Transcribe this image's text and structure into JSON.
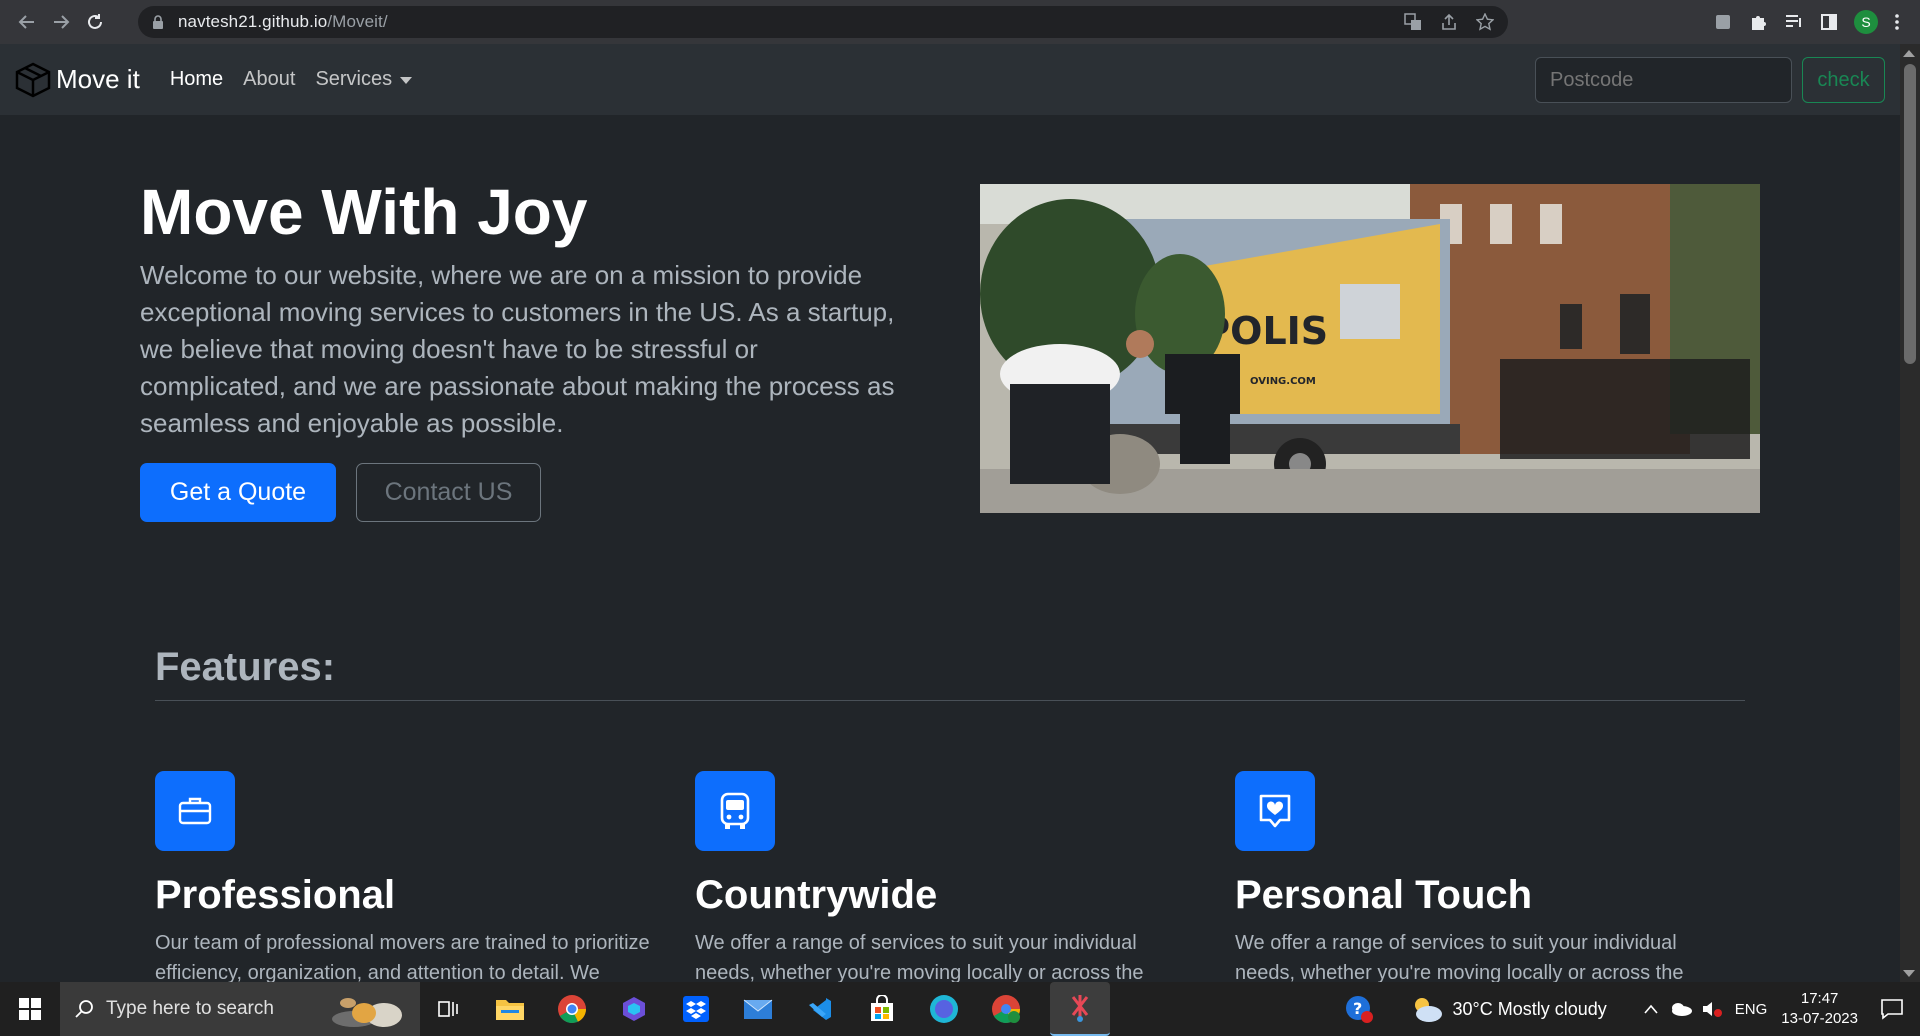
{
  "browser": {
    "url_host": "navtesh21.github.io",
    "url_path": "/Moveit/",
    "profile_initial": "S"
  },
  "navbar": {
    "brand": "Move it",
    "links": [
      {
        "label": "Home",
        "active": true
      },
      {
        "label": "About",
        "active": false
      },
      {
        "label": "Services",
        "active": false,
        "dropdown": true
      }
    ],
    "postcode_placeholder": "Postcode",
    "check_label": "check"
  },
  "hero": {
    "title": "Move With Joy",
    "text": "Welcome to our website, where we are on a mission to provide exceptional moving services to customers in the US. As a startup, we believe that moving doesn't have to be stressful or complicated, and we are passionate about making the process as seamless and enjoyable as possible.",
    "quote_button": "Get a Quote",
    "contact_button": "Contact US",
    "image_truck_text": "OPOLIS",
    "image_truck_web": "OVING.COM"
  },
  "features": {
    "heading": "Features:",
    "items": [
      {
        "icon": "briefcase-icon",
        "title": "Professional",
        "text": "Our team of professional movers are trained to prioritize efficiency, organization, and attention to detail. We"
      },
      {
        "icon": "bus-icon",
        "title": "Countrywide",
        "text": "We offer a range of services to suit your individual needs, whether you're moving locally or across the country. Our"
      },
      {
        "icon": "heart-chat-icon",
        "title": "Personal Touch",
        "text": "We offer a range of services to suit your individual needs, whether you're moving locally or across the country. Our"
      }
    ]
  },
  "taskbar": {
    "search_placeholder": "Type here to search",
    "weather": "30°C  Mostly cloudy",
    "language": "ENG",
    "time": "17:47",
    "date": "13-07-2023"
  },
  "colors": {
    "primary": "#0d6efd",
    "success": "#198754",
    "page_bg": "#212529",
    "navbar_bg": "#2b3035"
  }
}
